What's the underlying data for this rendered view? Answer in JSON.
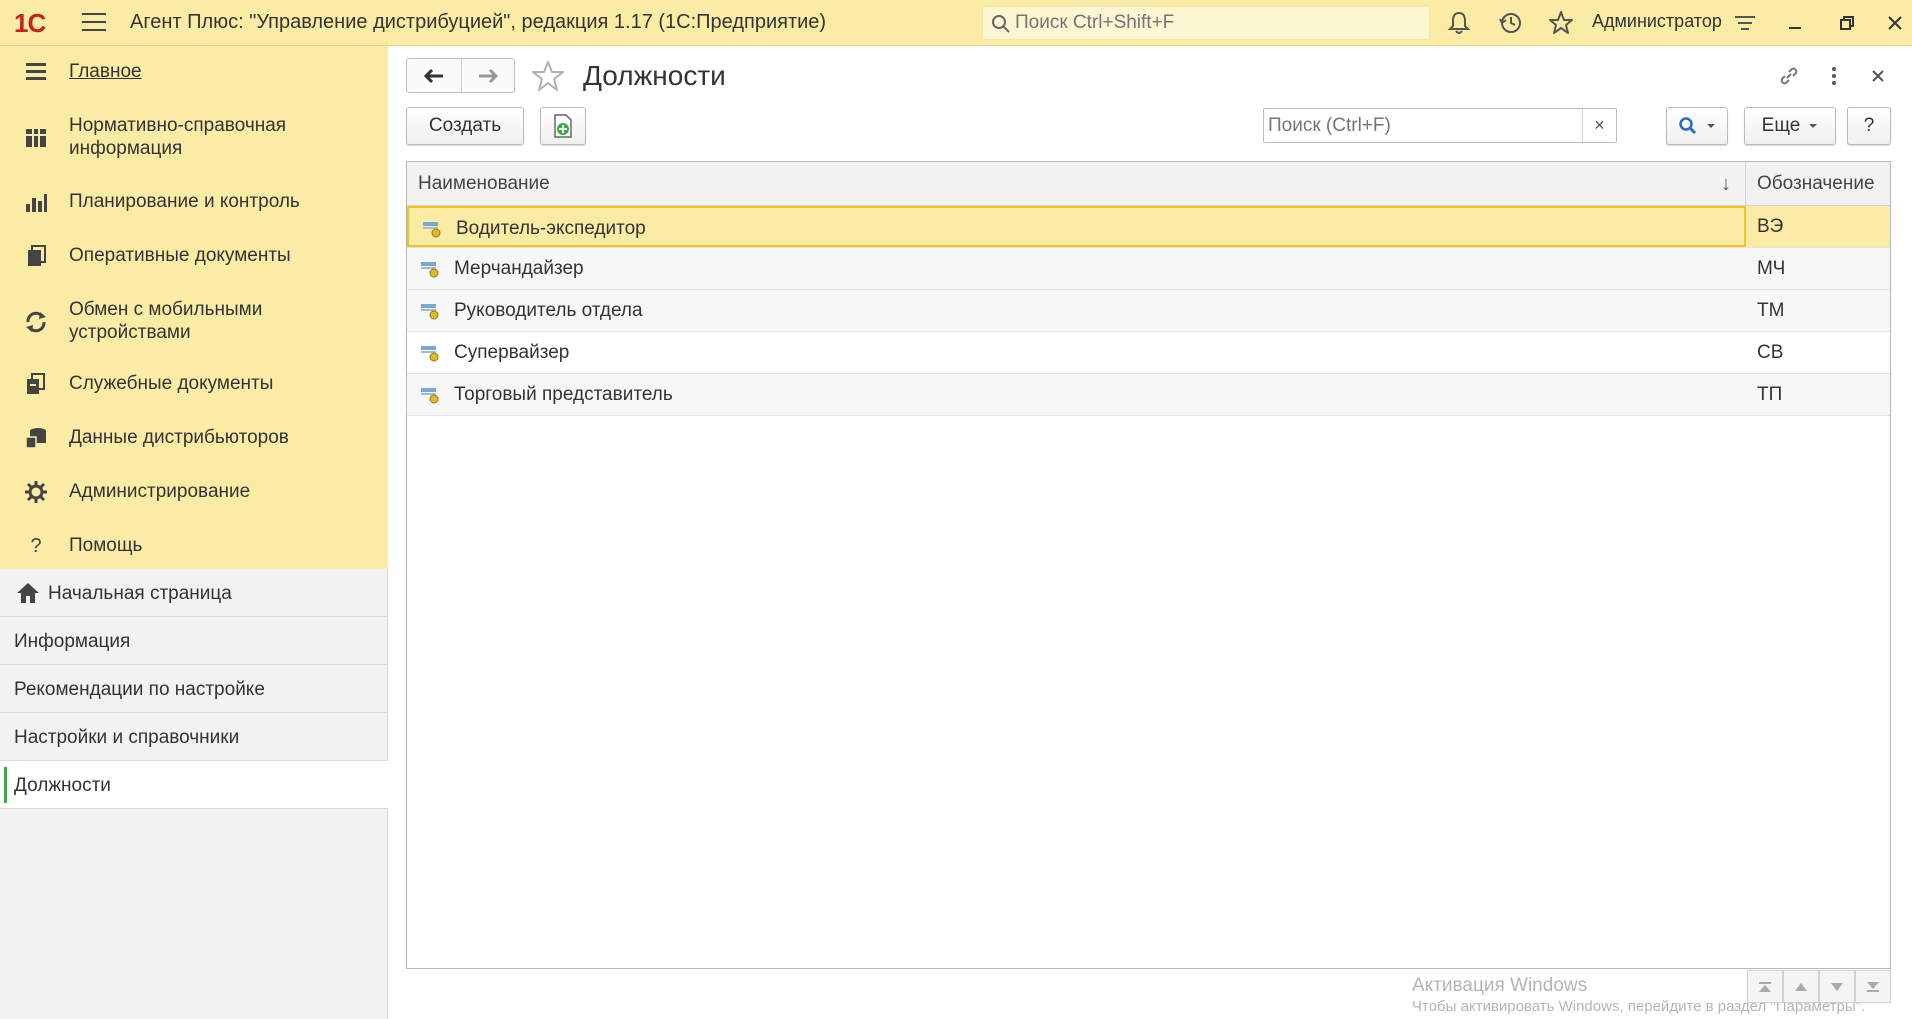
{
  "titlebar": {
    "logo_text": "1С",
    "app_title": "Агент Плюс: \"Управление дистрибуцией\", редакция 1.17  (1С:Предприятие)",
    "search_placeholder": "Поиск Ctrl+Shift+F",
    "user_name": "Администратор",
    "icons": [
      "bell-icon",
      "history-icon",
      "star-icon",
      "settings-menu-icon",
      "minimize-icon",
      "restore-icon",
      "close-icon"
    ]
  },
  "sidebar": {
    "sections": [
      {
        "label": "Главное",
        "icon": "menu-lines-icon"
      },
      {
        "label": "Нормативно-справочная информация",
        "icon": "reference-grid-icon"
      },
      {
        "label": "Планирование и контроль",
        "icon": "bar-chart-icon"
      },
      {
        "label": "Оперативные документы",
        "icon": "documents-icon"
      },
      {
        "label": "Обмен с мобильными устройствами",
        "icon": "sync-icon"
      },
      {
        "label": "Служебные документы",
        "icon": "service-docs-icon"
      },
      {
        "label": "Данные дистрибьюторов",
        "icon": "distributor-data-icon"
      },
      {
        "label": "Администрирование",
        "icon": "gear-icon"
      },
      {
        "label": "Помощь",
        "icon": "help-icon"
      }
    ],
    "open_windows": [
      {
        "label": "Начальная страница",
        "icon": "home-icon"
      },
      {
        "label": "Информация"
      },
      {
        "label": "Рекомендации по настройке"
      },
      {
        "label": "Настройки и справочники"
      },
      {
        "label": "Должности",
        "active": true
      }
    ]
  },
  "form": {
    "title": "Должности",
    "create_label": "Создать",
    "search_placeholder": "Поиск (Ctrl+F)",
    "clear_label": "×",
    "more_label": "Еще",
    "help_label": "?",
    "columns": {
      "name": "Наименование",
      "code": "Обозначение",
      "sort_indicator": "↓"
    },
    "rows": [
      {
        "name": "Водитель-экспедитор",
        "code": "ВЭ",
        "selected": true
      },
      {
        "name": "Мерчандайзер",
        "code": "МЧ"
      },
      {
        "name": "Руководитель отдела",
        "code": "ТМ"
      },
      {
        "name": "Супервайзер",
        "code": "СВ"
      },
      {
        "name": "Торговый представитель",
        "code": "ТП"
      }
    ]
  },
  "watermark": {
    "line1": "Активация Windows",
    "line2": "Чтобы активировать Windows, перейдите в раздел \"Параметры\"."
  },
  "colors": {
    "accent_yellow": "#fbeca5",
    "selection_border": "#f4c41d",
    "logo_red": "#c8201e",
    "active_marker_green": "#3aa843"
  }
}
